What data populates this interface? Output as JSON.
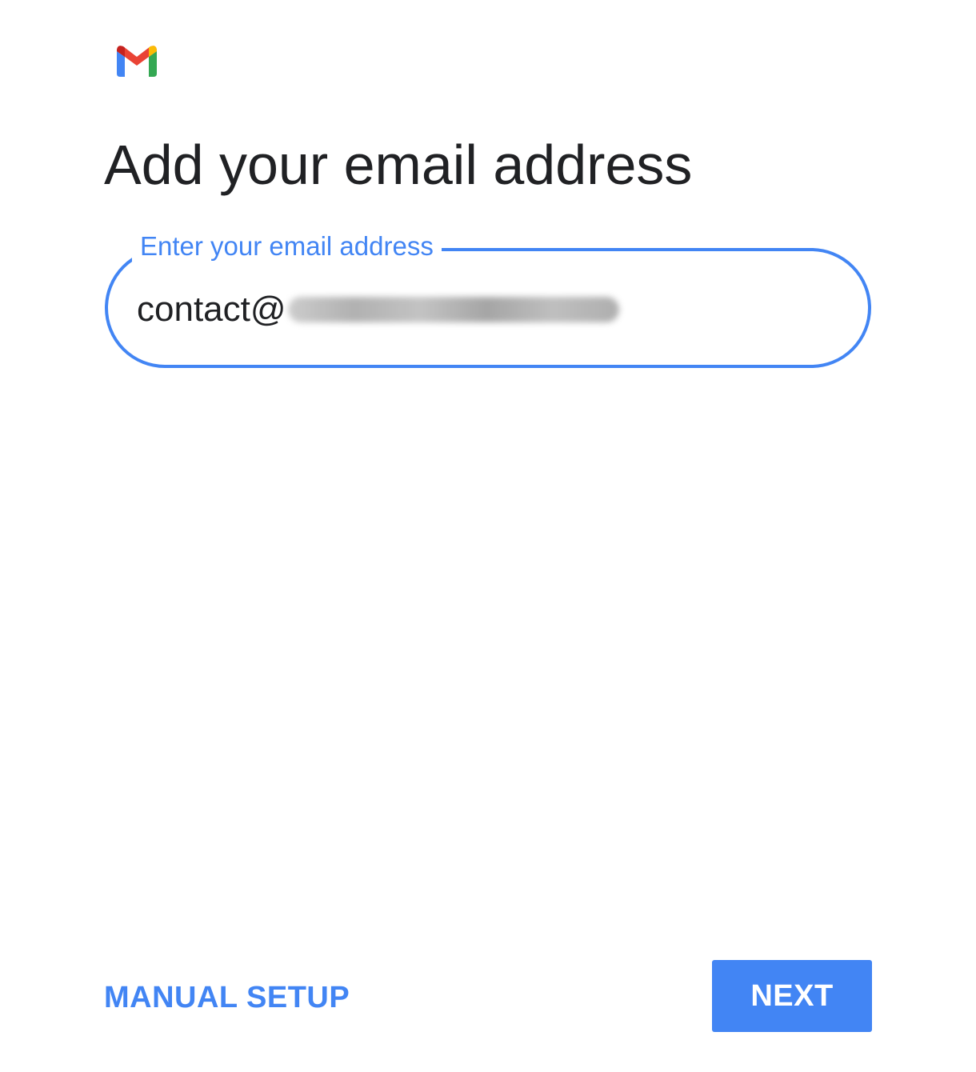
{
  "app": {
    "logo_icon": "gmail-icon"
  },
  "header": {
    "title": "Add your email address"
  },
  "email_field": {
    "label": "Enter your email address",
    "value": "contact@"
  },
  "footer": {
    "manual_setup_label": "MANUAL SETUP",
    "next_label": "NEXT"
  },
  "colors": {
    "accent": "#4285f4",
    "text": "#202124",
    "background": "#ffffff",
    "gmail_red": "#ea4335",
    "gmail_blue": "#4285f4",
    "gmail_green": "#34a853",
    "gmail_yellow": "#fbbc04",
    "gmail_dark_red": "#c5221f"
  }
}
